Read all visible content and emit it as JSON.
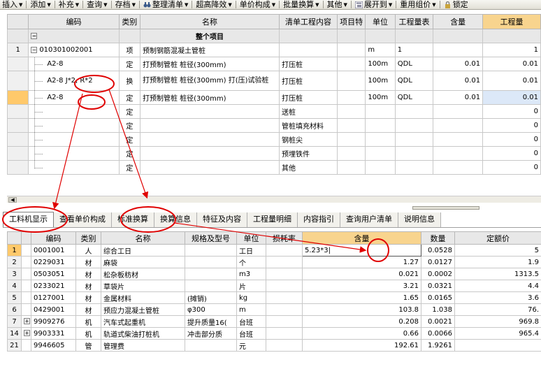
{
  "toolbar": {
    "items": [
      "插入",
      "添加",
      "补充",
      "查询",
      "存档",
      "整理清单",
      "超高降效",
      "单价构成",
      "批量换算",
      "其他",
      "展开到",
      "重用组价",
      "锁定"
    ]
  },
  "upper": {
    "headers": [
      "编码",
      "类别",
      "名称",
      "清单工程内容",
      "项目特",
      "单位",
      "工程量表",
      "含量",
      "工程量"
    ],
    "total_label": "整个项目",
    "total_collapse": "−",
    "rows": [
      {
        "rn": "1",
        "code": "010301002001",
        "pm": "−",
        "type": "项",
        "name": "预制钢筋混凝土管桩",
        "content": "",
        "feat": "",
        "unit": "m",
        "expr": "1",
        "qty": "",
        "amount": "1"
      },
      {
        "rn": "",
        "code": "A2-8",
        "type": "定",
        "name": "打预制管桩 桩径(300mm)",
        "content": "打压桩",
        "feat": "",
        "unit": "100m",
        "expr": "QDL",
        "qty": "0.01",
        "amount": "0.01"
      },
      {
        "rn": "",
        "code": "A2-8",
        "code_extra": "J*2, R*2",
        "type": "换",
        "name": "打预制管桩 桩径(300mm) 打(压)试验桩",
        "content": "打压桩",
        "feat": "",
        "unit": "100m",
        "expr": "QDL",
        "qty": "0.01",
        "amount": "0.01"
      },
      {
        "rn": "",
        "code": "A2-8",
        "type": "定",
        "name": "打预制管桩 桩径(300mm)",
        "content": "打压桩",
        "feat": "",
        "unit": "100m",
        "expr": "QDL",
        "qty": "0.01",
        "amount": "0.01"
      },
      {
        "rn": "",
        "code": "",
        "type": "定",
        "name": "",
        "content": "送桩",
        "feat": "",
        "unit": "",
        "expr": "",
        "qty": "",
        "amount": "0"
      },
      {
        "rn": "",
        "code": "",
        "type": "定",
        "name": "",
        "content": "管桩填充材料",
        "feat": "",
        "unit": "",
        "expr": "",
        "qty": "",
        "amount": "0"
      },
      {
        "rn": "",
        "code": "",
        "type": "定",
        "name": "",
        "content": "钢桩尖",
        "feat": "",
        "unit": "",
        "expr": "",
        "qty": "",
        "amount": "0"
      },
      {
        "rn": "",
        "code": "",
        "type": "定",
        "name": "",
        "content": "预埋铁件",
        "feat": "",
        "unit": "",
        "expr": "",
        "qty": "",
        "amount": "0"
      },
      {
        "rn": "",
        "code": "",
        "type": "定",
        "name": "",
        "content": "其他",
        "feat": "",
        "unit": "",
        "expr": "",
        "qty": "",
        "amount": "0"
      }
    ]
  },
  "tabs": [
    "工料机显示",
    "查看单价构成",
    "标准换算",
    "换算信息",
    "特征及内容",
    "工程量明细",
    "内容指引",
    "查询用户清单",
    "说明信息"
  ],
  "lower": {
    "headers": [
      "编码",
      "类别",
      "名称",
      "规格及型号",
      "单位",
      "损耗率",
      "含量",
      "数量",
      "定额价"
    ],
    "rows": [
      {
        "rn": "1",
        "pm": "",
        "code": "0001001",
        "type": "人",
        "name": "综合工日",
        "spec": "",
        "unit": "工日",
        "loss": "",
        "content": "5.23*3|",
        "qty": "0.0528",
        "price": "5"
      },
      {
        "rn": "2",
        "pm": "",
        "code": "0229031",
        "type": "材",
        "name": "麻袋",
        "spec": "",
        "unit": "个",
        "loss": "",
        "content": "1.27",
        "qty": "0.0127",
        "price": "1.9"
      },
      {
        "rn": "3",
        "pm": "",
        "code": "0503051",
        "type": "材",
        "name": "松杂板枋材",
        "spec": "",
        "unit": "m3",
        "loss": "",
        "content": "0.021",
        "qty": "0.0002",
        "price": "1313.5"
      },
      {
        "rn": "4",
        "pm": "",
        "code": "0233021",
        "type": "材",
        "name": "草袋片",
        "spec": "",
        "unit": "片",
        "loss": "",
        "content": "3.21",
        "qty": "0.0321",
        "price": "4.4"
      },
      {
        "rn": "5",
        "pm": "",
        "code": "0127001",
        "type": "材",
        "name": "金属材料",
        "spec": "(摊销)",
        "unit": "kg",
        "loss": "",
        "content": "1.65",
        "qty": "0.0165",
        "price": "3.6"
      },
      {
        "rn": "6",
        "pm": "",
        "code": "0429001",
        "type": "材",
        "name": "预应力混凝土管桩",
        "spec": "φ300",
        "unit": "m",
        "loss": "",
        "content": "103.8",
        "qty": "1.038",
        "price": "76."
      },
      {
        "rn": "7",
        "pm": "+",
        "code": "9909276",
        "type": "机",
        "name": "汽车式起重机",
        "spec": "提升质量16(",
        "unit": "台班",
        "loss": "",
        "content": "0.208",
        "qty": "0.0021",
        "price": "969.8"
      },
      {
        "rn": "14",
        "pm": "+",
        "code": "9903331",
        "type": "机",
        "name": "轨道式柴油打桩机",
        "spec": "冲击部分质",
        "unit": "台班",
        "loss": "",
        "content": "0.66",
        "qty": "0.0066",
        "price": "965.4"
      },
      {
        "rn": "21",
        "pm": "",
        "code": "9946605",
        "type": "管",
        "name": "管理费",
        "spec": "",
        "unit": "元",
        "loss": "",
        "content": "192.61",
        "qty": "1.9261",
        "price": ""
      }
    ]
  },
  "colors": {
    "annotation": "#e00000",
    "highlight_header": "#f8d48e",
    "selected_row": "#ffc96b"
  }
}
